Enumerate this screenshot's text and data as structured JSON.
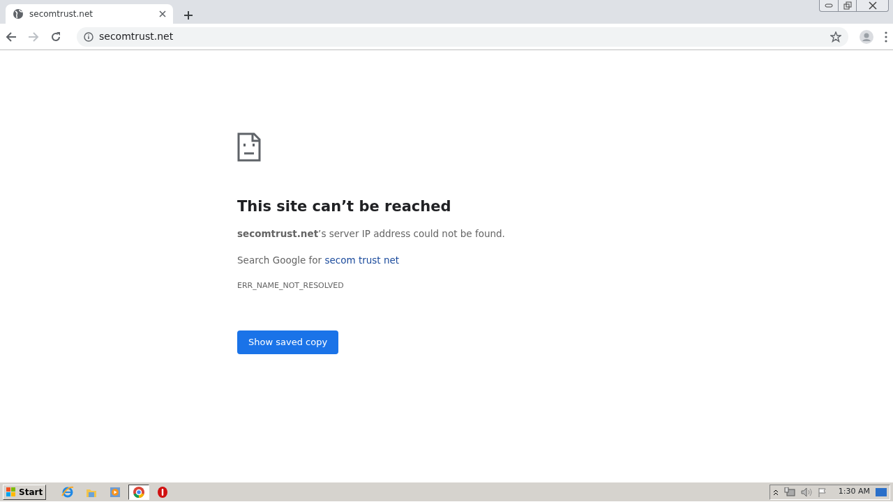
{
  "tab": {
    "title": "secomtrust.net"
  },
  "address_bar": {
    "url": "secomtrust.net"
  },
  "error": {
    "heading": "This site can’t be reached",
    "message": "**secomtrust.net**’s server IP address could not be found.",
    "search_prefix": "Search Google for ",
    "search_link": "secom trust net",
    "code": "ERR_NAME_NOT_RESOLVED",
    "button": "Show saved copy"
  },
  "taskbar": {
    "start": "Start",
    "apps": [
      {
        "kind": "browser-e",
        "selected": false
      },
      {
        "kind": "folder",
        "selected": false
      },
      {
        "kind": "media",
        "selected": false
      },
      {
        "kind": "chrome",
        "selected": true
      },
      {
        "kind": "stop",
        "selected": false
      }
    ],
    "clock": "1:30 AM"
  }
}
